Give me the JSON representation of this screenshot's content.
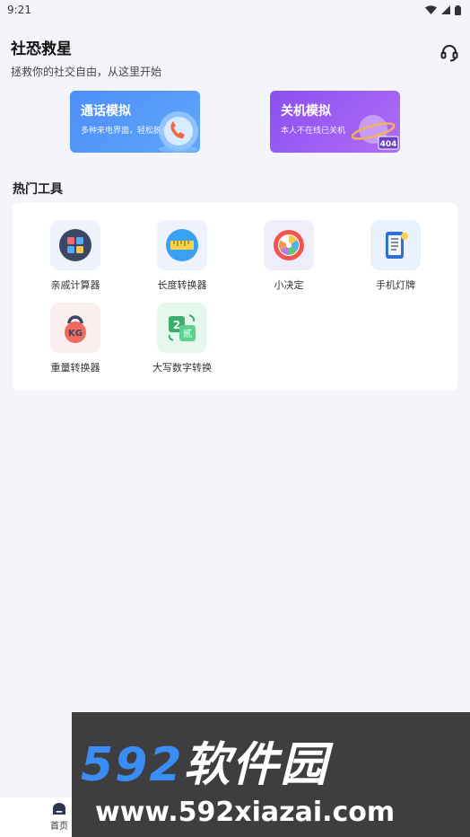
{
  "status_bar": {
    "time": "9:21"
  },
  "header": {
    "title": "社恐救星",
    "subtitle": "拯救你的社交自由，从这里开始",
    "support_icon": "headset-icon"
  },
  "feature_cards": [
    {
      "title": "通话模拟",
      "desc": "多种来电界面，轻松脱身",
      "icon": "phone-bubble-icon",
      "color": "#4d8ef7"
    },
    {
      "title": "关机模拟",
      "desc": "本人不在线已关机",
      "icon": "planet-404-icon",
      "color": "#8a4ff0"
    }
  ],
  "tools_section": {
    "title": "热门工具",
    "items": [
      {
        "label": "亲戚计算器",
        "icon": "calculator-icon"
      },
      {
        "label": "长度转换器",
        "icon": "ruler-icon"
      },
      {
        "label": "小决定",
        "icon": "spinner-wheel-icon"
      },
      {
        "label": "手机灯牌",
        "icon": "phone-light-sign-icon"
      },
      {
        "label": "重量转换器",
        "icon": "kettlebell-icon"
      },
      {
        "label": "大写数字转换",
        "icon": "number-convert-icon"
      }
    ]
  },
  "bottom_nav": {
    "home_label": "首页"
  },
  "watermark": {
    "brand_num": "592",
    "brand_text": "软件园",
    "url": "www.592xiazai.com"
  }
}
